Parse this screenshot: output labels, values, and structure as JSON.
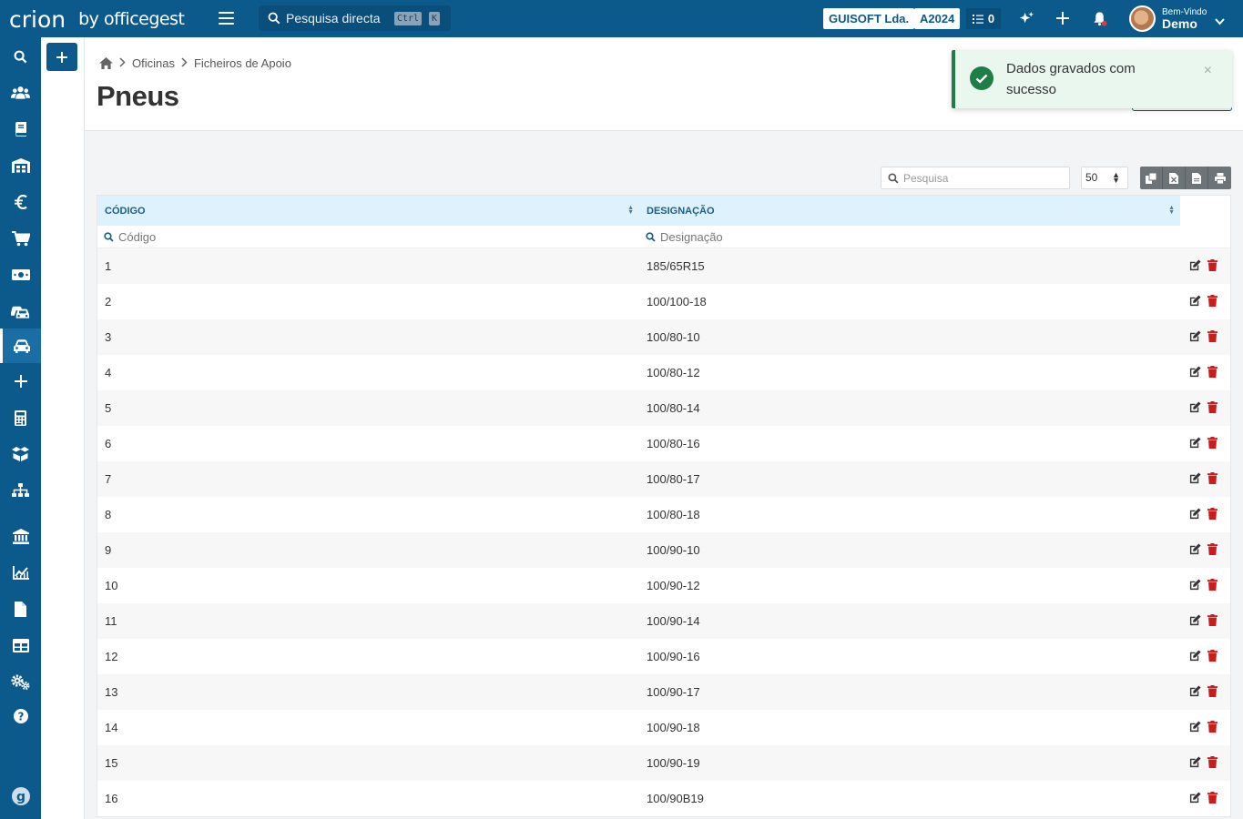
{
  "app": {
    "logo_main": "crion",
    "logo_sub": "by officegest"
  },
  "topbar": {
    "search_label": "Pesquisa directa",
    "kbd_ctrl": "Ctrl",
    "kbd_k": "K",
    "company": "GUISOFT Lda.",
    "year": "A2024",
    "tasks_count": "0",
    "welcome": "Bem-Vindo",
    "user": "Demo"
  },
  "sidebar": {
    "items": [
      "search-icon",
      "users-icon",
      "book-icon",
      "warehouse-icon",
      "euro-icon",
      "cart-icon",
      "money-icon",
      "car-shop-icon",
      "car-icon",
      "plus-icon",
      "calculator-icon",
      "boxes-icon",
      "sitemap-icon",
      "bank-icon",
      "chart-icon",
      "file-icon",
      "table-icon",
      "cogs-icon",
      "help-icon"
    ],
    "active": "car-icon"
  },
  "breadcrumb": {
    "level1": "Oficinas",
    "level2": "Ficheiros de Apoio"
  },
  "page_title": "Pneus",
  "toast": {
    "message": "Dados gravados com sucesso",
    "close": "×"
  },
  "toolbar": {
    "search_placeholder": "Pesquisa",
    "page_size": "50"
  },
  "table": {
    "columns": [
      "CÓDIGO",
      "DESIGNAÇÃO"
    ],
    "filters": [
      "Código",
      "Designação"
    ],
    "rows": [
      [
        "1",
        "185/65R15"
      ],
      [
        "2",
        "100/100-18"
      ],
      [
        "3",
        "100/80-10"
      ],
      [
        "4",
        "100/80-12"
      ],
      [
        "5",
        "100/80-14"
      ],
      [
        "6",
        "100/80-16"
      ],
      [
        "7",
        "100/80-17"
      ],
      [
        "8",
        "100/80-18"
      ],
      [
        "9",
        "100/90-10"
      ],
      [
        "10",
        "100/90-12"
      ],
      [
        "11",
        "100/90-14"
      ],
      [
        "12",
        "100/90-16"
      ],
      [
        "13",
        "100/90-17"
      ],
      [
        "14",
        "100/90-18"
      ],
      [
        "15",
        "100/90-19"
      ],
      [
        "16",
        "100/90B19"
      ]
    ]
  },
  "colors": {
    "brand": "#0c5a8c",
    "header_bg": "#ddf2fc",
    "delete": "#c91c1c",
    "success": "#1e7e45"
  }
}
